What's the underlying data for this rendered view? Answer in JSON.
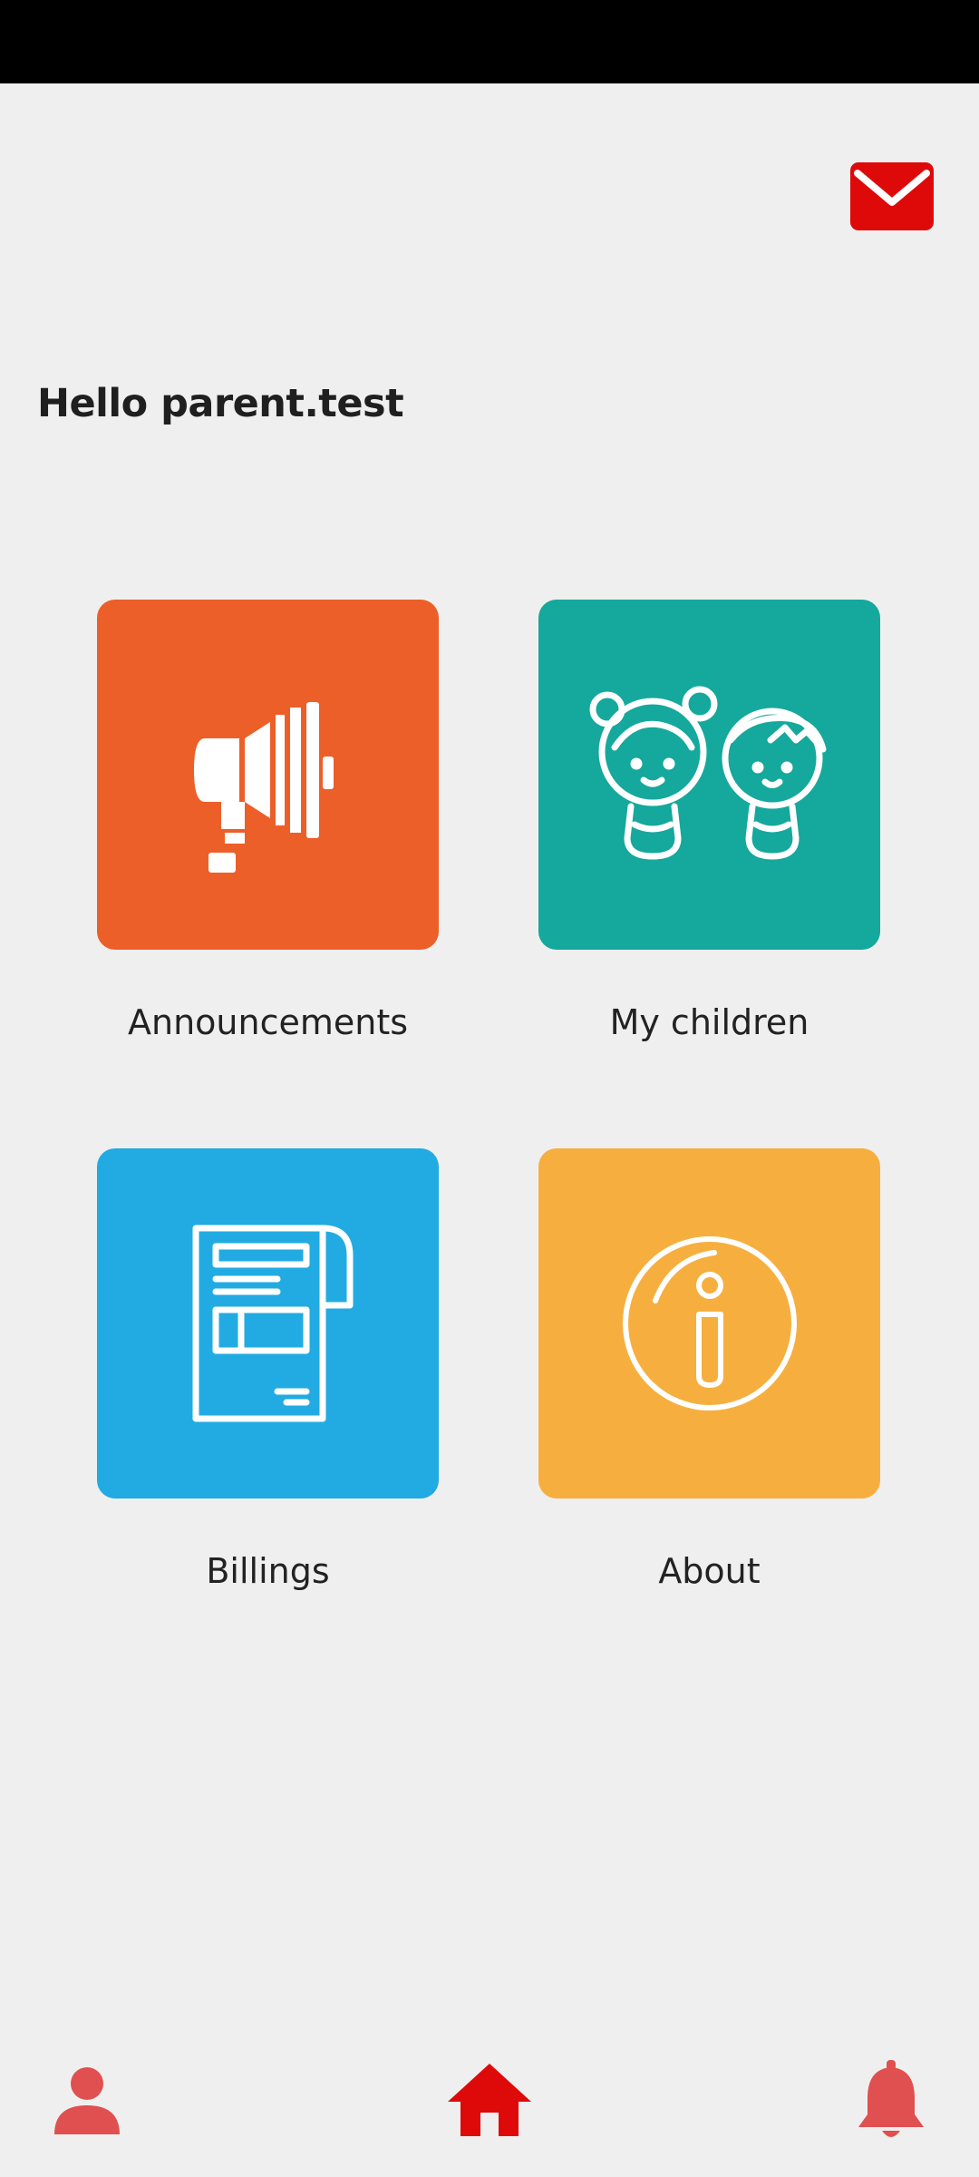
{
  "header": {
    "greeting": "Hello parent.test",
    "mail_icon": "envelope-icon",
    "accent_color": "#de0a0a"
  },
  "tiles": [
    {
      "label": "Announcements",
      "icon": "megaphone-icon",
      "color": "#ec5f29"
    },
    {
      "label": "My children",
      "icon": "children-icon",
      "color": "#15a89c"
    },
    {
      "label": "Billings",
      "icon": "receipt-icon",
      "color": "#22abe2"
    },
    {
      "label": "About",
      "icon": "info-icon",
      "color": "#f6af3f"
    }
  ],
  "bottom_nav": {
    "items": [
      {
        "icon": "person-icon",
        "color": "#e05050"
      },
      {
        "icon": "home-icon",
        "color": "#de0a0a"
      },
      {
        "icon": "bell-icon",
        "color": "#e05050"
      }
    ]
  }
}
